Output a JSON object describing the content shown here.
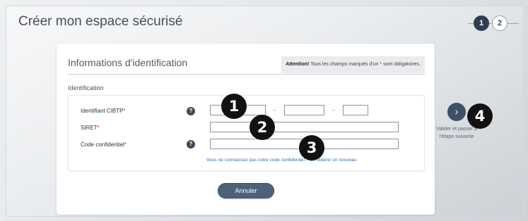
{
  "header": {
    "title": "Créer mon espace sécurisé",
    "steps": [
      "1",
      "2"
    ],
    "active_step": 1
  },
  "card": {
    "title": "Informations d'identification",
    "notice_strong": "Attention!",
    "notice_text": "Tous les champs marqués d'un",
    "notice_star": "*",
    "notice_tail": "sont obligatoires.",
    "section_label": "Identification",
    "fields": {
      "cibtp": {
        "label": "Identifiant CIBTP",
        "required": "*",
        "help": "?"
      },
      "siret": {
        "label": "SIRET",
        "required": "*"
      },
      "code": {
        "label": "Code confidentiel",
        "required": "*",
        "help": "?"
      }
    },
    "separators": [
      "-",
      "-"
    ],
    "forgot_link": "Vous ne connaissez pas votre code confidentiel ? En obtenir un nouveau",
    "cancel_label": "Annuler"
  },
  "next": {
    "icon": "chevron-right-icon",
    "glyph": "›",
    "caption": "Valider et passer à l'étape suivante"
  },
  "markers": [
    "1",
    "2",
    "3",
    "4"
  ],
  "colors": {
    "primary_dark": "#2f3e52",
    "button": "#4d6279",
    "required": "#e0262c",
    "link": "#2e6fb0"
  }
}
